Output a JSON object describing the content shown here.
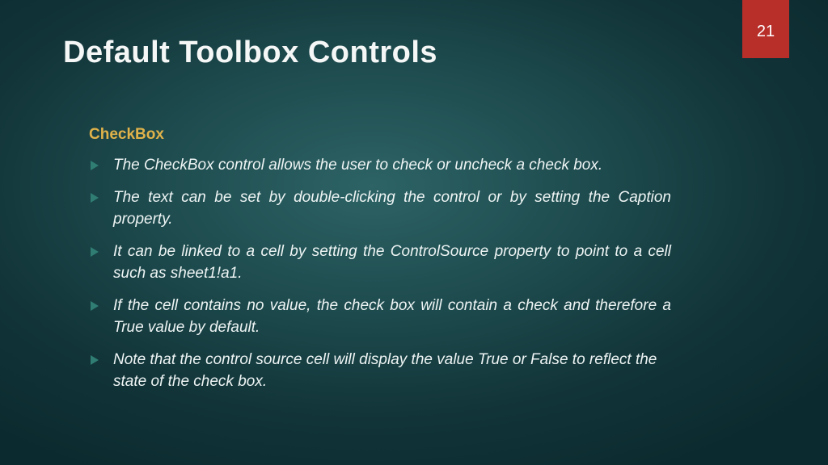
{
  "page_number": "21",
  "title": "Default Toolbox Controls",
  "section_heading": "CheckBox",
  "bullets": [
    "The CheckBox control allows the user to check or uncheck a check box.",
    "The text can be set by double-clicking the control or by setting the Caption property.",
    "It can be linked to a cell by setting the ControlSource property to point to a cell such as sheet1!a1.",
    "If the cell contains no value, the check box will contain a check and therefore a True value by default.",
    "Note that the control source cell will display the value True or False to reflect the state of the check box."
  ]
}
